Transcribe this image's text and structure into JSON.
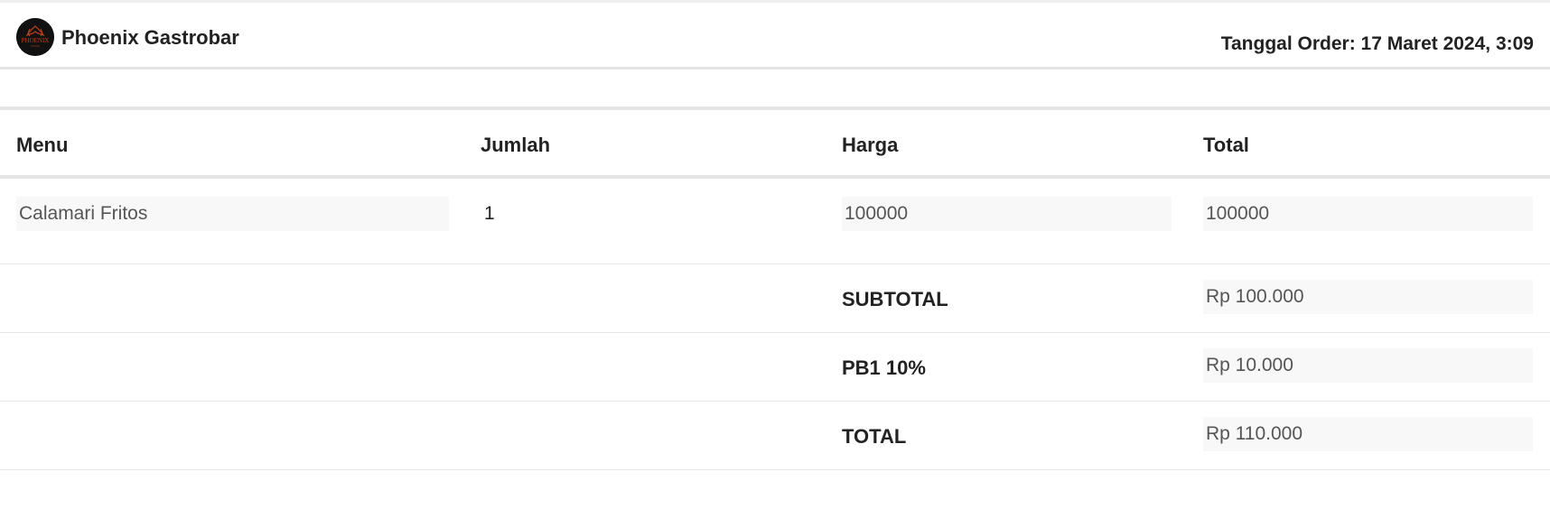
{
  "header": {
    "brand_name": "Phoenix Gastrobar",
    "logo_text": "PHOENIX",
    "order_date": "Tanggal Order: 17 Maret 2024, 3:09"
  },
  "table": {
    "columns": [
      "Menu",
      "Jumlah",
      "Harga",
      "Total"
    ],
    "items": [
      {
        "menu": "Calamari Fritos",
        "qty": "1",
        "price": "100000",
        "total": "100000"
      }
    ]
  },
  "summary": [
    {
      "label": "SUBTOTAL",
      "value": "Rp 100.000"
    },
    {
      "label": "PB1 10%",
      "value": "Rp 10.000"
    },
    {
      "label": "TOTAL",
      "value": "Rp 110.000"
    }
  ],
  "colors": {
    "logo_bg": "#111111",
    "logo_accent": "#c0441b",
    "field_bg": "#f8f8f8",
    "rule": "#e4e4e4"
  }
}
